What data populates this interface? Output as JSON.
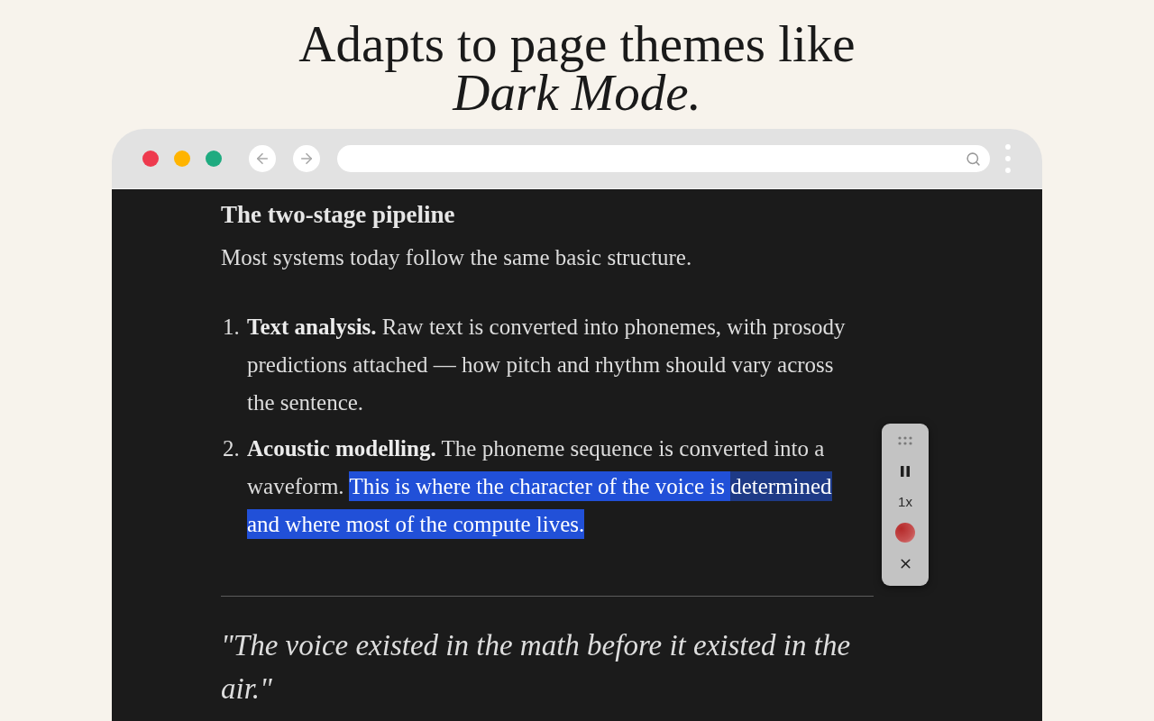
{
  "headline": "Adapts to page themes like *Dark Mode.*",
  "article": {
    "heading": "The two-stage pipeline",
    "intro": "Most systems today follow the same basic structure.",
    "steps": [
      {
        "number": "1.",
        "lead": "Text analysis.",
        "segments": [
          {
            "kind": "plain",
            "text": "Raw text is converted into phonemes, with prosody predictions attached — how pitch and rhythm should vary across the sentence."
          }
        ]
      },
      {
        "number": "2.",
        "lead": "Acoustic modelling.",
        "segments": [
          {
            "kind": "plain",
            "text": "The phoneme sequence is converted into a waveform. "
          },
          {
            "kind": "highlight",
            "text": "This is where the character of the voice is "
          },
          {
            "kind": "current",
            "text": "determined"
          },
          {
            "kind": "highlight",
            "text": " and where most of the compute lives."
          }
        ]
      }
    ],
    "quote": "\"The voice existed in the math before it existed in the air.\""
  },
  "player": {
    "playing": true,
    "speed": "1x"
  }
}
